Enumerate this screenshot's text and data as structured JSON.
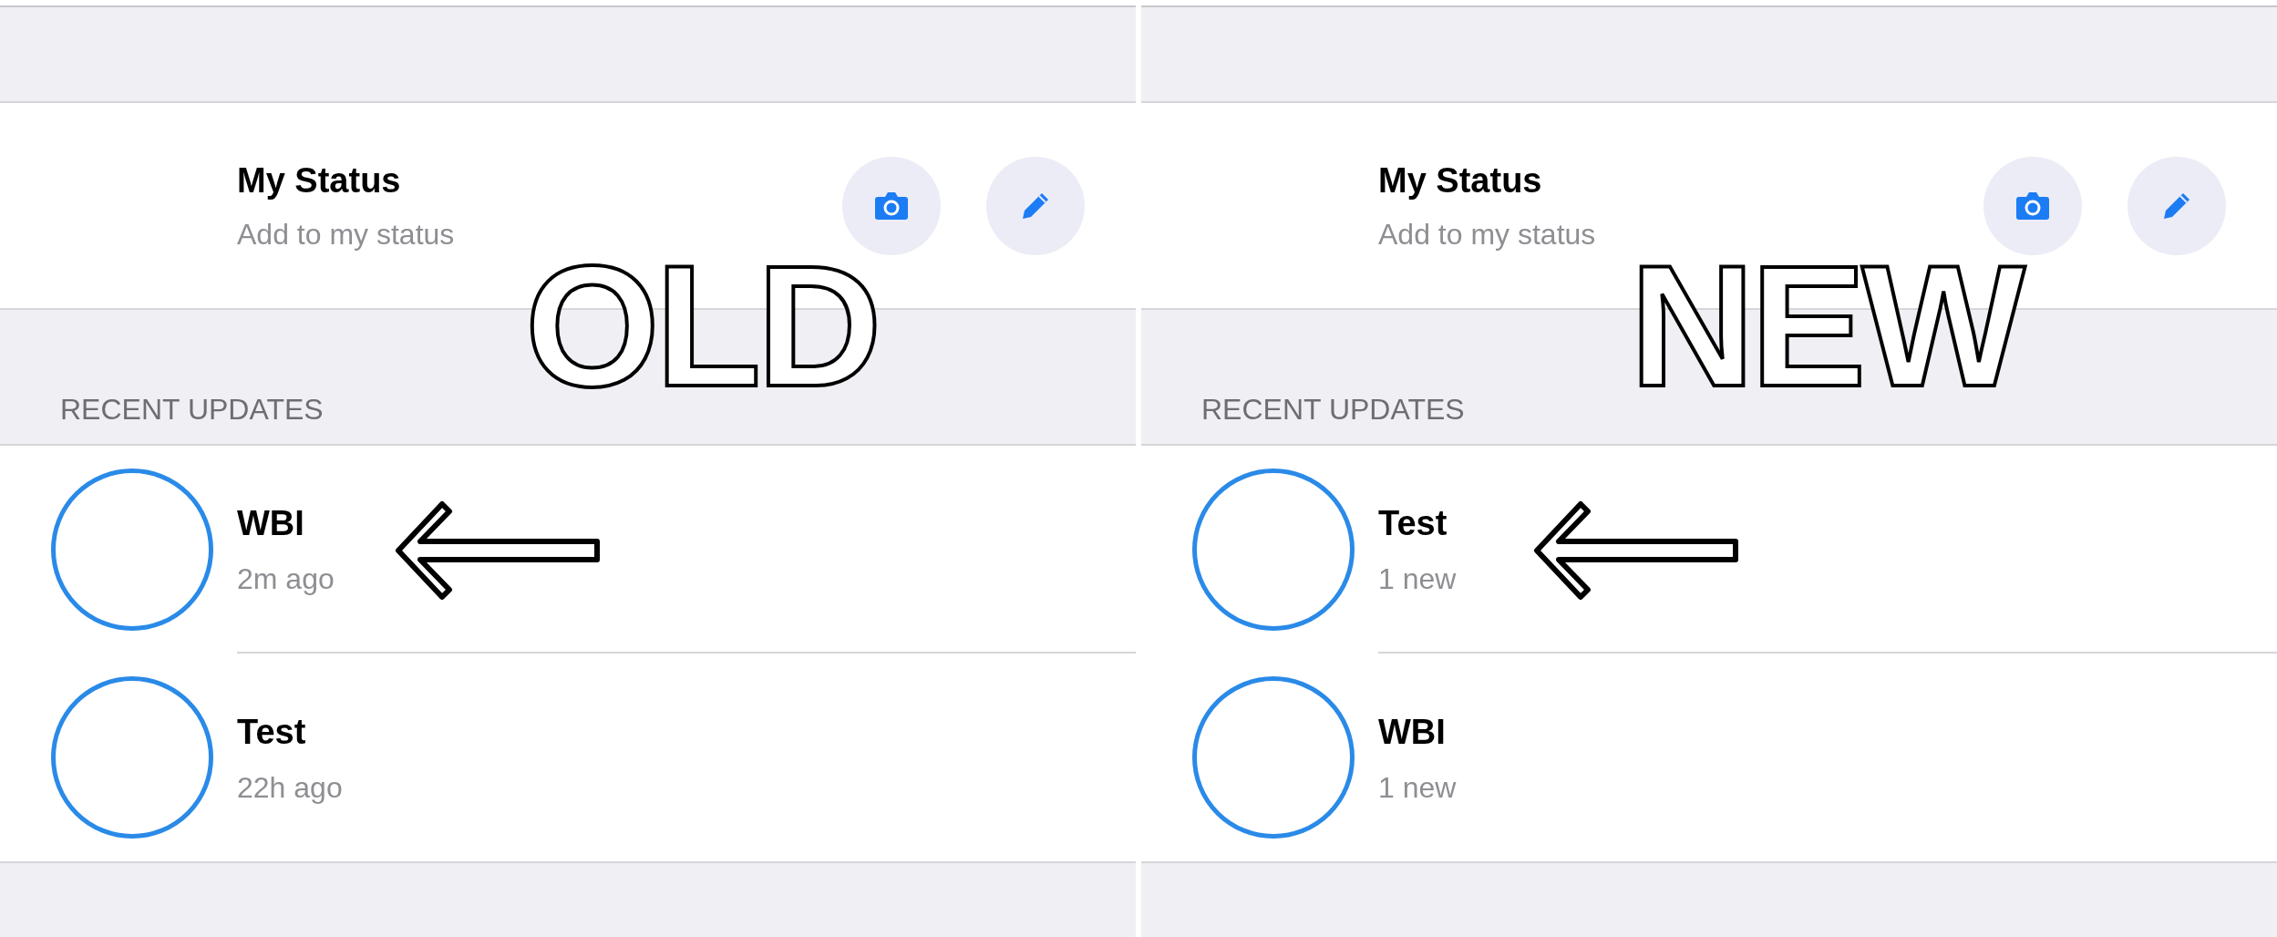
{
  "panels": [
    {
      "label": "OLD",
      "my_status": {
        "title": "My Status",
        "subtitle": "Add to my status"
      },
      "section_header": "RECENT UPDATES",
      "updates": [
        {
          "name": "WBI",
          "time": "2m ago",
          "arrow": true
        },
        {
          "name": "Test",
          "time": "22h ago",
          "arrow": false
        }
      ]
    },
    {
      "label": "NEW",
      "my_status": {
        "title": "My Status",
        "subtitle": "Add to my status"
      },
      "section_header": "RECENT UPDATES",
      "updates": [
        {
          "name": "Test",
          "time": "1 new",
          "arrow": true
        },
        {
          "name": "WBI",
          "time": "1 new",
          "arrow": false
        }
      ]
    }
  ]
}
